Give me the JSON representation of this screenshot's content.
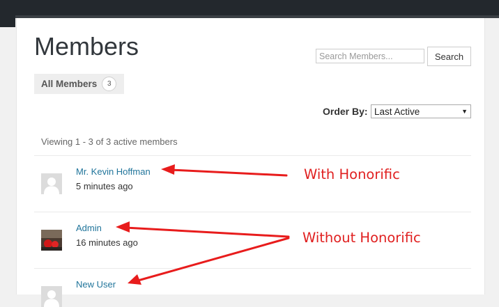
{
  "page": {
    "title": "Members"
  },
  "search": {
    "placeholder": "Search Members...",
    "button_label": "Search"
  },
  "tabs": [
    {
      "label": "All Members",
      "count": "3"
    }
  ],
  "order": {
    "label": "Order By:",
    "selected": "Last Active"
  },
  "viewing_text": "Viewing 1 - 3 of 3 active members",
  "members": [
    {
      "name": "Mr. Kevin Hoffman",
      "time": "5 minutes ago",
      "avatar": "default-avatar-icon"
    },
    {
      "name": "Admin",
      "time": "16 minutes ago",
      "avatar": "photo-avatar"
    },
    {
      "name": "New User",
      "time": "",
      "avatar": "default-avatar-icon"
    }
  ],
  "annotations": {
    "with_label": "With Honorific",
    "without_label": "Without Honorific"
  },
  "colors": {
    "link": "#21759b",
    "annotation": "#e02020",
    "topbar": "#23282d"
  }
}
